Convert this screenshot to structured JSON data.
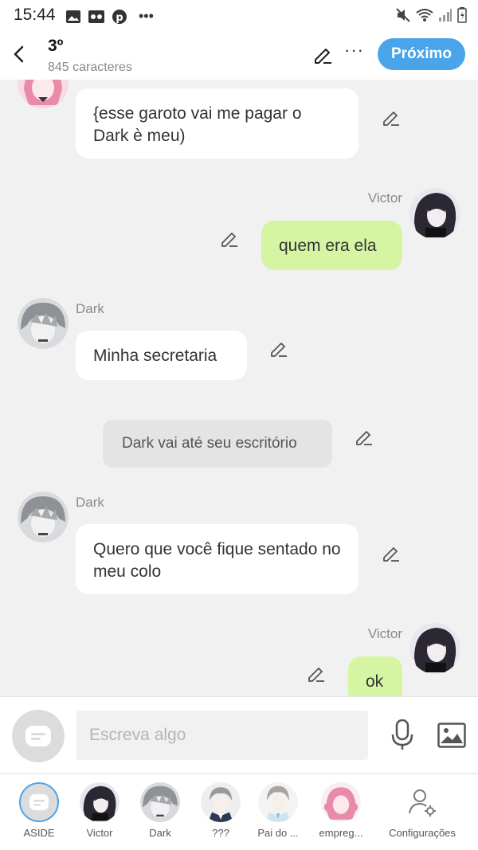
{
  "status_bar": {
    "time": "15:44"
  },
  "header": {
    "title": "3º",
    "subtitle": "845 caracteres",
    "next_label": "Próximo"
  },
  "messages": [
    {
      "sender": "",
      "side": "left",
      "kind": "speech",
      "text": "{esse garoto vai me pagar o Dark è meu)"
    },
    {
      "sender": "Victor",
      "side": "right",
      "kind": "speech",
      "text": "quem era ela"
    },
    {
      "sender": "Dark",
      "side": "left",
      "kind": "speech",
      "text": "Minha secretaria"
    },
    {
      "sender": "",
      "side": "center",
      "kind": "narration",
      "text": "Dark vai até seu escritório"
    },
    {
      "sender": "Dark",
      "side": "left",
      "kind": "speech",
      "text": "Quero que você fique sentado no meu colo"
    },
    {
      "sender": "Victor",
      "side": "right",
      "kind": "speech",
      "text": "ok"
    }
  ],
  "composer": {
    "placeholder": "Escreva algo"
  },
  "nav": {
    "items": [
      {
        "label": "ASIDE"
      },
      {
        "label": "Victor"
      },
      {
        "label": "Dark"
      },
      {
        "label": "???"
      },
      {
        "label": "Pai do ..."
      },
      {
        "label": "empreg..."
      },
      {
        "label": "Configurações"
      }
    ]
  },
  "colors": {
    "accent": "#4aa4ea",
    "bubble_self": "#d6f5a3",
    "bubble_other": "#ffffff",
    "narration": "#e4e4e4",
    "background": "#f1f1f1"
  }
}
